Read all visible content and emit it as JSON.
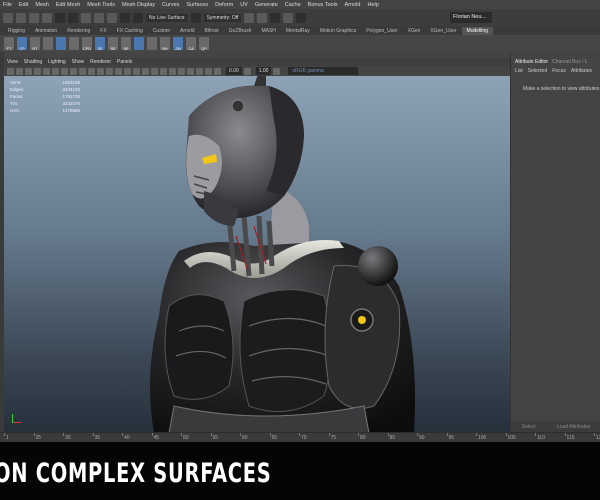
{
  "menubar": [
    "File",
    "Edit",
    "Mesh",
    "Edit Mesh",
    "Mesh Tools",
    "Mesh Display",
    "Curves",
    "Surfaces",
    "Deform",
    "UV",
    "Generate",
    "Cache",
    "Bonus Tools",
    "Arnold",
    "Help"
  ],
  "statusline": {
    "live_surface": "No Live Surface",
    "symmetry": "Symmetry: Off",
    "user": "Florian Neu..."
  },
  "shelf_tabs": [
    "Rigging",
    "Animation",
    "Rendering",
    "FX",
    "FX Caching",
    "Custom",
    "Arnold",
    "Bifrost",
    "GoZBrush",
    "MASH",
    "MentalRay",
    "Motion Graphics",
    "Polygon_User",
    "XGen",
    "XGen_User",
    "Modelling"
  ],
  "shelf_tabs_active": "Modelling",
  "shelf_icons": [
    {
      "name": "ft-icon",
      "label": "FT"
    },
    {
      "name": "cp-icon",
      "label": "CP"
    },
    {
      "name": "rt-icon",
      "label": "RT"
    },
    {
      "name": "a1-icon",
      "label": ""
    },
    {
      "name": "a2-icon",
      "label": ""
    },
    {
      "name": "a3-icon",
      "label": ""
    },
    {
      "name": "cpd-icon",
      "label": "CPD"
    },
    {
      "name": "se-icon",
      "label": "SE"
    },
    {
      "name": "se2-icon",
      "label": "SE"
    },
    {
      "name": "se3-icon",
      "label": "SE"
    },
    {
      "name": "a4-icon",
      "label": ""
    },
    {
      "name": "a5-icon",
      "label": ""
    },
    {
      "name": "bh-icon",
      "label": "BH"
    },
    {
      "name": "zm-icon",
      "label": "ZM"
    },
    {
      "name": "ca-icon",
      "label": "CA"
    },
    {
      "name": "qp-icon",
      "label": "QP"
    }
  ],
  "viewport": {
    "menu": [
      "View",
      "Shading",
      "Lighting",
      "Show",
      "Renderer",
      "Panels"
    ],
    "field1": "0.00",
    "field2": "1.00",
    "camera": "sRGB gamma"
  },
  "hud": [
    {
      "label": "Verts:",
      "value": "1563158"
    },
    {
      "label": "Edges:",
      "value": "3434120"
    },
    {
      "label": "Faces:",
      "value": "1791735"
    },
    {
      "label": "Tris:",
      "value": "3233475"
    },
    {
      "label": "UVs:",
      "value": "1479866"
    }
  ],
  "right_panel": {
    "tabs": [
      "Attribute Editor",
      "Channel Box / L"
    ],
    "sub": [
      "List",
      "Selected",
      "Focus",
      "Attributes"
    ],
    "message": "Make a selection to view attributes",
    "bottom": [
      "Select",
      "Load Attributes"
    ]
  },
  "timeline_ticks": [
    "1",
    "25",
    "30",
    "35",
    "40",
    "45",
    "50",
    "55",
    "60",
    "65",
    "70",
    "75",
    "80",
    "85",
    "90",
    "95",
    "100",
    "105",
    "110",
    "115",
    "12"
  ],
  "banner": "ON COMPLEX SURFACES",
  "colors": {
    "accent": "#f2c615",
    "viewport_top": "#8ea3b6",
    "viewport_bottom": "#25303b"
  }
}
